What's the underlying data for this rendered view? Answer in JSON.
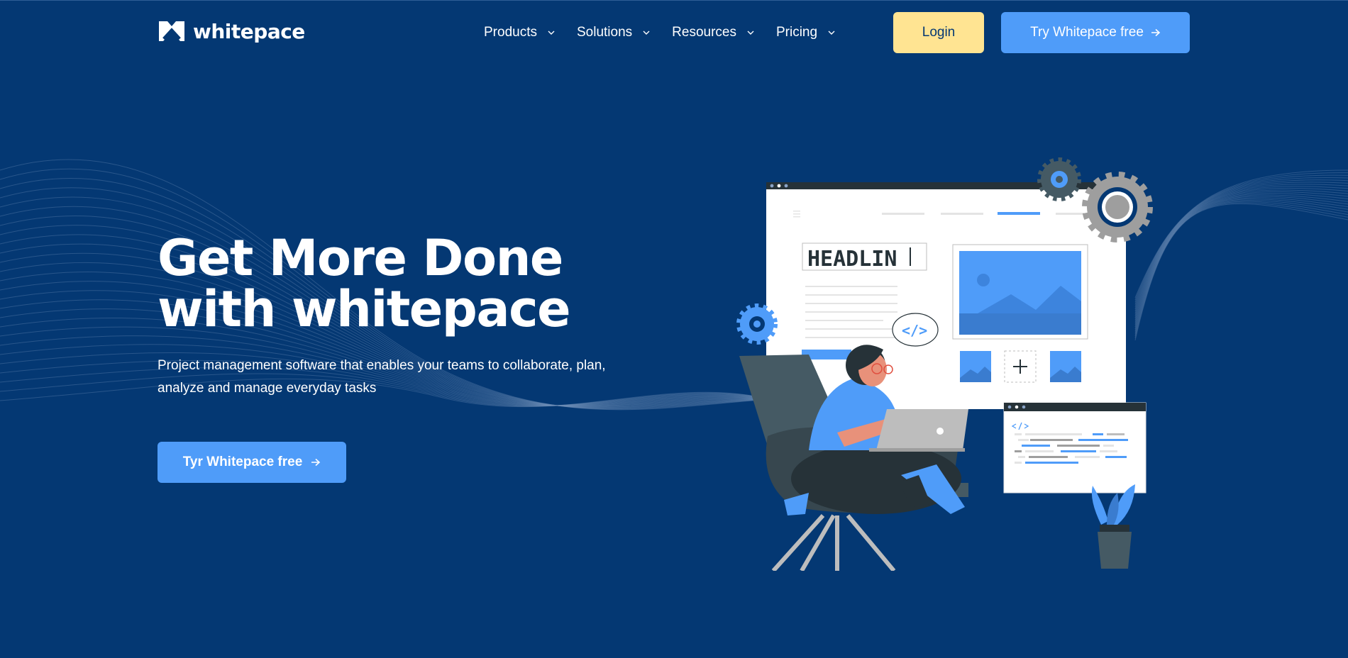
{
  "brand": {
    "name": "whitepace"
  },
  "nav": {
    "items": [
      {
        "label": "Products"
      },
      {
        "label": "Solutions"
      },
      {
        "label": "Resources"
      },
      {
        "label": "Pricing"
      }
    ]
  },
  "header": {
    "login_label": "Login",
    "try_label": "Try Whitepace free"
  },
  "hero": {
    "title_line1": "Get More Done",
    "title_line2": "with whitepace",
    "subtitle": "Project management software that enables your teams to collaborate, plan, analyze and manage everyday tasks",
    "cta_label": "Tyr Whitepace free"
  },
  "illustration": {
    "headline_text": "HEADLIN",
    "code_tag": "</>"
  },
  "icons": {
    "logo": "whitepace-logo-icon",
    "nav_dropdown": "chevron-down-icon",
    "cta_arrow": "arrow-right-icon"
  },
  "colors": {
    "background": "#043873",
    "accent_blue": "#4f9cf9",
    "login_yellow": "#ffe492"
  }
}
